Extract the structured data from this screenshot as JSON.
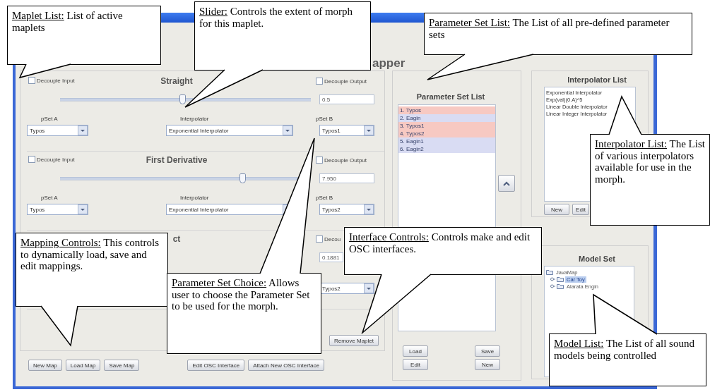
{
  "window": {
    "title": "apper"
  },
  "maplets": [
    {
      "title": "Straight",
      "decouple_input": {
        "label": "Decouple Input",
        "checked": false
      },
      "decouple_output": {
        "label": "Decouple Output",
        "checked": false
      },
      "level": 0.49,
      "value": "0.5",
      "pset_a_label": "pSet A",
      "interpolator_label": "Interpolator",
      "pset_b_label": "pSet B",
      "pset_a": "Typos",
      "interpolator": "Exponential Interpolator",
      "pset_b": "Typos1"
    },
    {
      "title": "First Derivative",
      "decouple_input": {
        "label": "Decouple Input",
        "checked": false
      },
      "decouple_output": {
        "label": "Decouple Output",
        "checked": false
      },
      "level": 0.73,
      "value": "7.950",
      "pset_a_label": "pSet A",
      "interpolator_label": "Interpolator",
      "pset_b_label": "pSet B",
      "pset_a": "Typos",
      "interpolator": "Exponential Interpolator",
      "pset_b": "Typos2"
    },
    {
      "title": "ct",
      "decouple_output": {
        "label": "Decou",
        "checked": false
      },
      "value": "0.1881",
      "pset_b": "Typos2"
    }
  ],
  "remove_button": "Remove Maplet",
  "mapping_buttons": [
    "New Map",
    "Load Map",
    "Save Map",
    "Edit OSC Interface",
    "Attach New OSC Interface"
  ],
  "parameter_set_list": {
    "title": "Parameter Set List",
    "items": [
      {
        "label": "1. Typos",
        "color": "#f7c9c2"
      },
      {
        "label": "2. Eagin",
        "color": "#d9dcf3"
      },
      {
        "label": "3. Typos1",
        "color": "#f7c9c2"
      },
      {
        "label": "4. Typos2",
        "color": "#f7c9c2"
      },
      {
        "label": "5. Eagin1",
        "color": "#d9dcf3"
      },
      {
        "label": "6. Eagin2",
        "color": "#d9dcf3"
      }
    ],
    "buttons": [
      "Load",
      "Save",
      "Edit",
      "New"
    ]
  },
  "interpolator_list": {
    "title": "Interpolator List",
    "items": [
      "Exponential Interpolator",
      "Exp(val)(0.A)^5",
      "Linear Double Interpolator",
      "Linear Integer Interpolator"
    ],
    "buttons": [
      "New",
      "Edit"
    ]
  },
  "model_set": {
    "title": "Model Set",
    "tree": [
      {
        "label": "JavaMap",
        "selected": false,
        "children": [
          {
            "label": "Car Toy",
            "selected": true
          },
          {
            "label": "Alarata Engin",
            "selected": false
          }
        ]
      }
    ]
  },
  "callouts": [
    {
      "heading": "Maplet List:",
      "text": "List of active maplets"
    },
    {
      "heading": "Slider:",
      "text": "Controls the extent of morph for this maplet."
    },
    {
      "heading": "Parameter Set List:",
      "text": "The List of all pre-defined parameter sets"
    },
    {
      "heading": "Interpolator List:",
      "text": "The List of various interpolators available for use in the morph."
    },
    {
      "heading": "Mapping Controls:",
      "text": "This controls to dynamically load, save and edit mappings."
    },
    {
      "heading": "Parameter Set Choice:",
      "text": "Allows user to choose the Parameter Set to be used for the morph."
    },
    {
      "heading": "Interface Controls:",
      "text": "Controls make and edit OSC interfaces."
    },
    {
      "heading": "Model List:",
      "text": "The List of all sound models being controlled"
    }
  ]
}
